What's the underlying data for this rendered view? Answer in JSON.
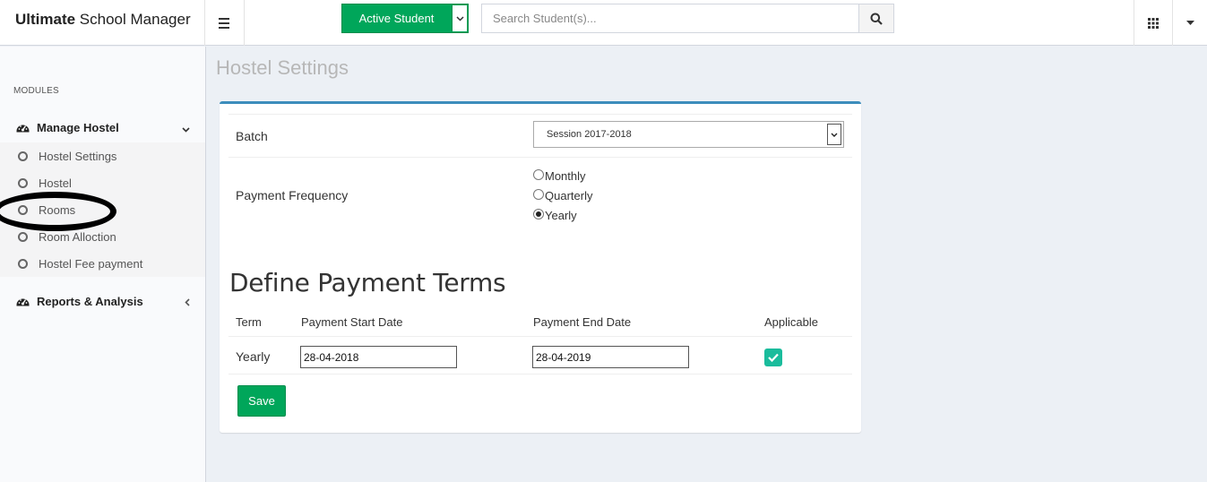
{
  "header": {
    "brand_bold": "Ultimate",
    "brand_rest": " School Manager",
    "student_status_button": "Active Student",
    "search_placeholder": "Search Student(s)..."
  },
  "sidebar": {
    "section_label": "MODULES",
    "groups": [
      {
        "label": "Manage Hostel",
        "icon": "dashboard-icon",
        "expanded": true,
        "items": [
          "Hostel Settings",
          "Hostel",
          "Rooms",
          "Room Alloction",
          "Hostel Fee payment"
        ]
      },
      {
        "label": "Reports & Analysis",
        "icon": "dashboard-icon",
        "expanded": false
      }
    ]
  },
  "page": {
    "title": "Hostel Settings",
    "batch_label": "Batch",
    "batch_value": "Session 2017-2018",
    "payment_frequency_label": "Payment Frequency",
    "frequency_options": [
      "Monthly",
      "Quarterly",
      "Yearly"
    ],
    "frequency_selected": "Yearly",
    "section_title": "Define Payment Terms",
    "table": {
      "headers": [
        "Term",
        "Payment Start Date",
        "Payment End Date",
        "Applicable"
      ],
      "rows": [
        {
          "term": "Yearly",
          "start": "28-04-2018",
          "end": "28-04-2019",
          "applicable": true
        }
      ]
    },
    "save_label": "Save"
  },
  "colors": {
    "accent_green": "#00a65a",
    "box_top_border": "#3c8dbc",
    "checkbox": "#1abc9c"
  }
}
